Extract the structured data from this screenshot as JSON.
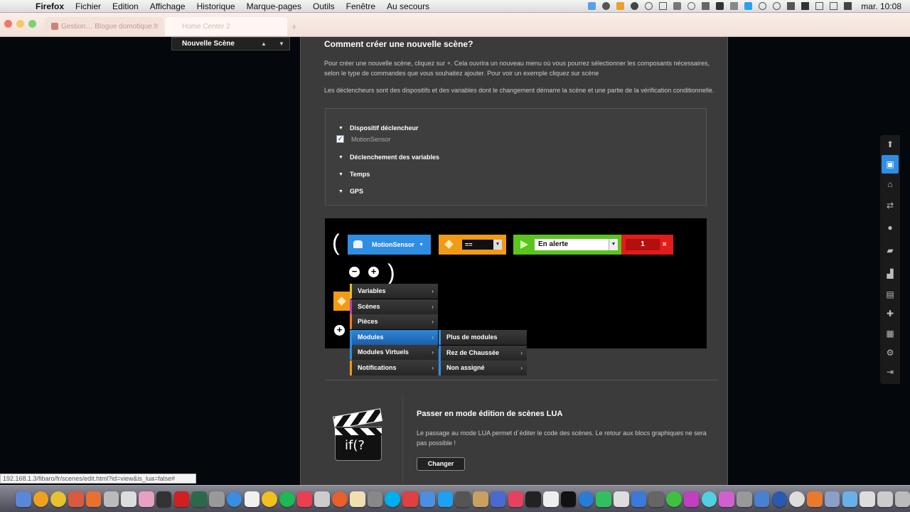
{
  "menubar": {
    "app": "Firefox",
    "items": [
      "Fichier",
      "Edition",
      "Affichage",
      "Historique",
      "Marque-pages",
      "Outils",
      "Fenêtre",
      "Au secours"
    ],
    "clock": "mar. 10:08"
  },
  "browser": {
    "tabs": [
      {
        "label": "Gestion… Blogue domotique.fr"
      },
      {
        "label": "Home Center 2"
      }
    ],
    "status_url": "192.168.1.3/fibaro/fr/scenes/edit.html?id=view&is_lua=false#"
  },
  "scene_bar": {
    "label": "Nouvelle Scène"
  },
  "help": {
    "title": "Comment créer une nouvelle scène?",
    "p1": "Pour créer une nouvelle scène, cliquez sur +. Cela ouvrira un nouveau menu où vous pourrez sélectionner les composants nécessaires, selon le type de commandes que vous souhaitez ajouter. Pour voir un exemple cliquez sur scène",
    "p2": "Les déclencheurs sont des dispositifs et des variables dont le changement démarre la scène et une partie de la vérification conditionnelle."
  },
  "triggers": {
    "device_header": "Dispositif déclencheur",
    "device_item": "MotionSensor",
    "variables": "Déclenchement des variables",
    "time": "Temps",
    "gps": "GPS"
  },
  "blocks": {
    "open_paren": "(",
    "close_paren": ")",
    "device": "MotionSensor",
    "operator": "==",
    "state": "En alerte",
    "value": "1",
    "remove_symbol": "−",
    "add_symbol": "+"
  },
  "context_menu": {
    "items": [
      "Variables",
      "Scènes",
      "Pièces",
      "Modules",
      "Modules Virtuels",
      "Notifications"
    ],
    "submenu": [
      "Plus de modules",
      "Rez de Chaussée",
      "Non assigné"
    ]
  },
  "lua": {
    "icon_text": "if(?",
    "title": "Passer en mode édition de scènes LUA",
    "text": "Le passage au mode LUA permet d´éditer le code des scènes. Le retour aux blocs graphiques ne sera pas possible !",
    "button": "Changer"
  },
  "colors": {
    "accent_blue": "#2f8ee4",
    "operator_orange": "#f09a16",
    "state_green": "#5cc41e",
    "value_red": "#e31b1b"
  }
}
